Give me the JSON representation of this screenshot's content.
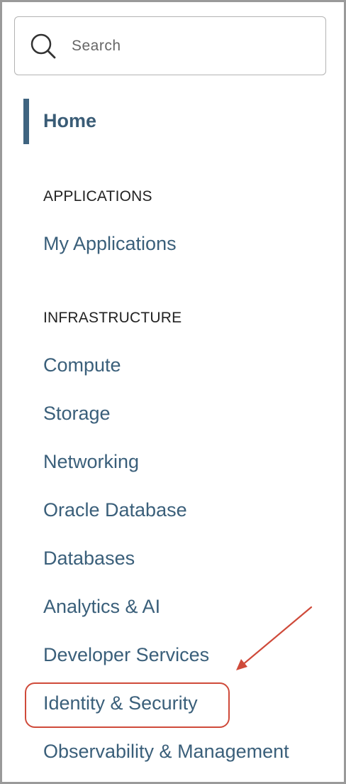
{
  "search": {
    "placeholder": "Search"
  },
  "nav": {
    "home_label": "Home",
    "sections": [
      {
        "heading": "APPLICATIONS",
        "items": [
          "My Applications"
        ]
      },
      {
        "heading": "INFRASTRUCTURE",
        "items": [
          "Compute",
          "Storage",
          "Networking",
          "Oracle Database",
          "Databases",
          "Analytics & AI",
          "Developer Services",
          "Identity & Security",
          "Observability & Management"
        ]
      }
    ],
    "highlighted_item": "Identity & Security"
  },
  "colors": {
    "accent": "#3f6480",
    "link": "#3a5f7a",
    "annotation": "#cf4a3a"
  }
}
